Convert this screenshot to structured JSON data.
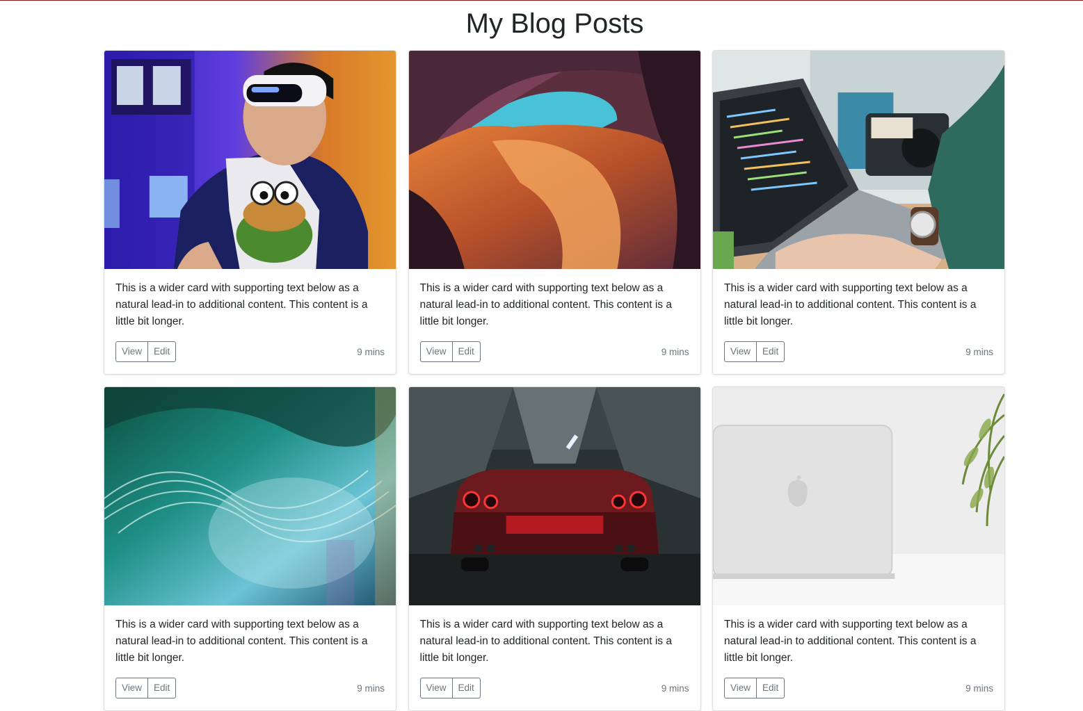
{
  "page": {
    "title": "My Blog Posts"
  },
  "cards": [
    {
      "image": "vr-headset-person-photo",
      "text": "This is a wider card with supporting text below as a natural lead-in to additional content. This content is a little bit longer.",
      "view_label": "View",
      "edit_label": "Edit",
      "time": "9 mins"
    },
    {
      "image": "canyon-rock-arch-photo",
      "text": "This is a wider card with supporting text below as a natural lead-in to additional content. This content is a little bit longer.",
      "view_label": "View",
      "edit_label": "Edit",
      "time": "9 mins"
    },
    {
      "image": "laptop-code-desk-photo",
      "text": "This is a wider card with supporting text below as a natural lead-in to additional content. This content is a little bit longer.",
      "view_label": "View",
      "edit_label": "Edit",
      "time": "9 mins"
    },
    {
      "image": "abstract-teal-waves-photo",
      "text": "This is a wider card with supporting text below as a natural lead-in to additional content. This content is a little bit longer.",
      "view_label": "View",
      "edit_label": "Edit",
      "time": "9 mins"
    },
    {
      "image": "red-car-garage-photo",
      "text": "This is a wider card with supporting text below as a natural lead-in to additional content. This content is a little bit longer.",
      "view_label": "View",
      "edit_label": "Edit",
      "time": "9 mins"
    },
    {
      "image": "white-laptop-plant-photo",
      "text": "This is a wider card with supporting text below as a natural lead-in to additional content. This content is a little bit longer.",
      "view_label": "View",
      "edit_label": "Edit",
      "time": "9 mins"
    }
  ]
}
